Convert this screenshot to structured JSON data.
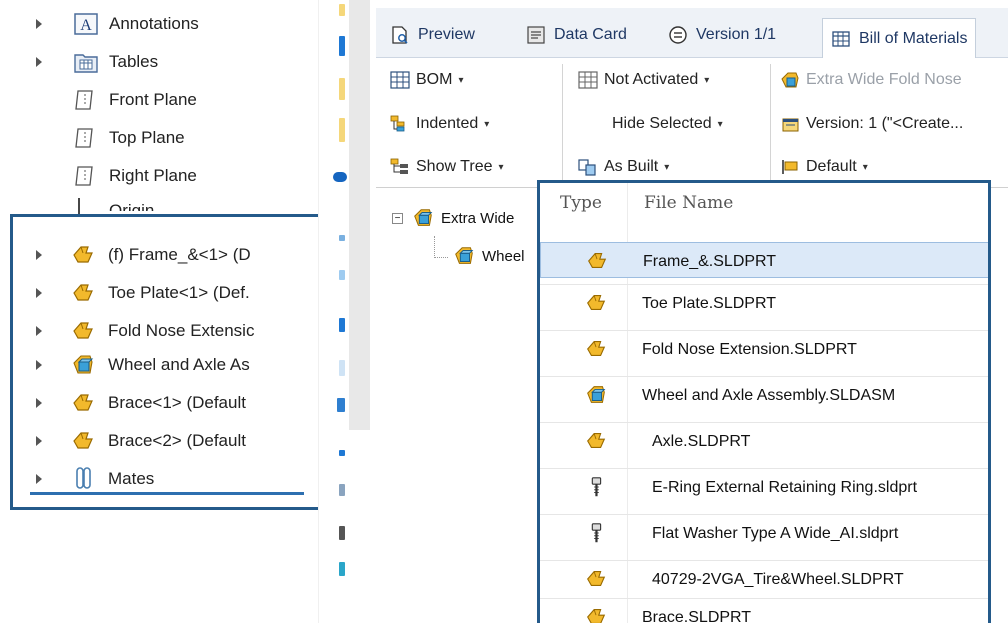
{
  "feature_tree": {
    "top_items": [
      {
        "label": "Annotations",
        "icon": "annotations-icon",
        "has_arrow": true
      },
      {
        "label": "Tables",
        "icon": "tables-icon",
        "has_arrow": true
      },
      {
        "label": "Front Plane",
        "icon": "plane-icon",
        "has_arrow": false
      },
      {
        "label": "Top Plane",
        "icon": "plane-icon",
        "has_arrow": false
      },
      {
        "label": "Right Plane",
        "icon": "plane-icon",
        "has_arrow": false
      },
      {
        "label": "Origin",
        "icon": "origin-icon",
        "has_arrow": false
      }
    ],
    "components": [
      {
        "label": "(f) Frame_&<1> (D",
        "icon": "part-icon"
      },
      {
        "label": "Toe Plate<1> (Def.",
        "icon": "part-icon"
      },
      {
        "label": "Fold Nose Extensic",
        "icon": "part-icon"
      },
      {
        "label": "Wheel and Axle As",
        "icon": "assembly-icon"
      },
      {
        "label": "Brace<1> (Default",
        "icon": "part-icon"
      },
      {
        "label": "Brace<2> (Default",
        "icon": "part-icon"
      },
      {
        "label": "Mates",
        "icon": "mates-icon"
      }
    ]
  },
  "pdm": {
    "tabs": [
      {
        "label": "Preview",
        "icon": "preview-icon"
      },
      {
        "label": "Data Card",
        "icon": "data-card-icon"
      },
      {
        "label": "Version 1/1",
        "icon": "version-icon"
      },
      {
        "label": "Bill of Materials",
        "icon": "bom-table-icon",
        "active": true
      }
    ],
    "ribbon": {
      "bom_type": "BOM",
      "view_mode": "Indented",
      "show_tree": "Show Tree",
      "activation": "Not Activated",
      "hide_selected": "Hide Selected",
      "as_built": "As Built",
      "assembly_name": "Extra Wide Fold Nose",
      "version_label": "Version: 1 (\"<Create...",
      "configuration": "Default"
    },
    "bom_tree": {
      "root_label": "Extra Wide",
      "child_label": "Wheel"
    },
    "bom_table": {
      "headers": {
        "type": "Type",
        "file_name": "File Name"
      },
      "rows": [
        {
          "type": "part-icon",
          "file_name": "Frame_&.SLDPRT",
          "selected": true,
          "indent": false
        },
        {
          "type": "part-icon",
          "file_name": "Toe Plate.SLDPRT",
          "selected": false,
          "indent": false
        },
        {
          "type": "part-icon",
          "file_name": "Fold Nose Extension.SLDPRT",
          "selected": false,
          "indent": false
        },
        {
          "type": "assembly-icon",
          "file_name": "Wheel and Axle Assembly.SLDASM",
          "selected": false,
          "indent": false
        },
        {
          "type": "part-icon",
          "file_name": "Axle.SLDPRT",
          "selected": false,
          "indent": true
        },
        {
          "type": "toolbox-icon",
          "file_name": "E-Ring External Retaining Ring.sldprt",
          "selected": false,
          "indent": true
        },
        {
          "type": "toolbox-icon",
          "file_name": "Flat Washer Type A Wide_AI.sldprt",
          "selected": false,
          "indent": true
        },
        {
          "type": "part-icon",
          "file_name": "40729-2VGA_Tire&Wheel.SLDPRT",
          "selected": false,
          "indent": true
        },
        {
          "type": "part-icon",
          "file_name": "Brace.SLDPRT",
          "selected": false,
          "indent": false
        }
      ]
    }
  },
  "colors": {
    "highlight_box": "#245a8a",
    "part_yellow": "#f2b92c",
    "assembly_blue": "#3aa0d8",
    "selected_row": "#dce9f8"
  }
}
